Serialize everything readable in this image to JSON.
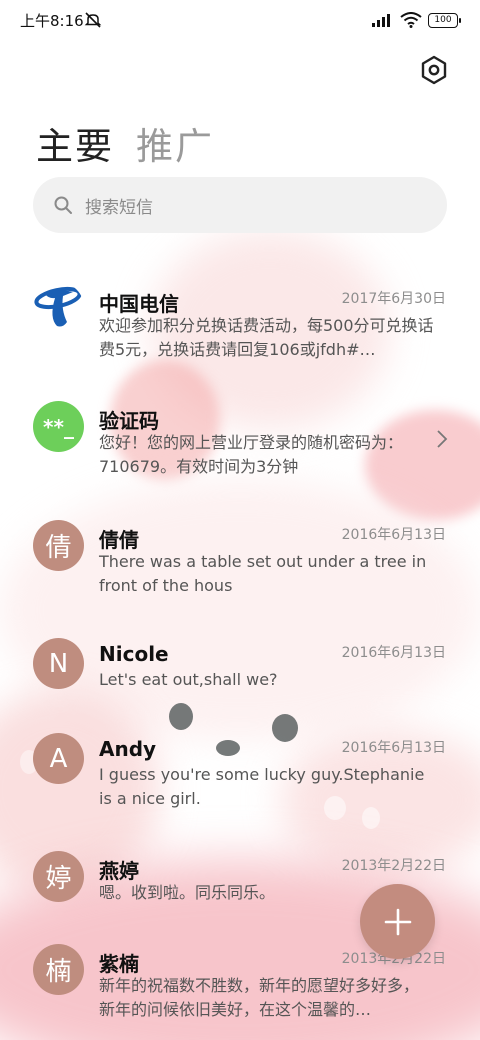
{
  "status_bar": {
    "time": "上午8:16",
    "battery": "100",
    "icons": [
      "mute-icon",
      "signal-icon",
      "wifi-icon",
      "battery-icon"
    ]
  },
  "header": {
    "settings_icon": "hexagon-settings-icon",
    "tabs": [
      {
        "label": "主要",
        "active": true
      },
      {
        "label": "推广",
        "active": false
      }
    ]
  },
  "search": {
    "placeholder": "搜索短信",
    "icon": "search-icon"
  },
  "messages": [
    {
      "name": "中国电信",
      "date": "2017年6月30日",
      "preview": "欢迎参加积分兑换话费活动，每500分可兑换话费5元，兑换话费请回复106或jfdh#…",
      "avatar": "china-telecom-logo"
    },
    {
      "name": "验证码",
      "date": "",
      "preview": "您好！您的网上营业厅登录的随机密码为：710679。有效时间为3分钟",
      "avatar_text": "**_",
      "avatar_color": "#6dcf5a"
    },
    {
      "name": "倩倩",
      "date": "2016年6月13日",
      "preview": "There was a table set out under a tree in front of the hous",
      "avatar_text": "倩"
    },
    {
      "name": "Nicole",
      "date": "2016年6月13日",
      "preview": "Let's eat out,shall we?",
      "avatar_text": "N"
    },
    {
      "name": "Andy",
      "date": "2016年6月13日",
      "preview": "I guess you're some lucky guy.Stephanie is a nice girl.",
      "avatar_text": "A"
    },
    {
      "name": "燕婷",
      "date": "2013年2月22日",
      "preview": "嗯。收到啦。同乐同乐。",
      "avatar_text": "婷"
    },
    {
      "name": "紫楠",
      "date": "2013年2月22日",
      "preview": "新年的祝福数不胜数，新年的愿望好多好多，新年的问候依旧美好，在这个温馨的…",
      "avatar_text": "楠"
    }
  ],
  "fab": {
    "icon": "plus-icon"
  },
  "colors": {
    "avatar": "#bf8d7f",
    "fab": "#c38c7f",
    "verify_avatar": "#6dcf5a"
  }
}
